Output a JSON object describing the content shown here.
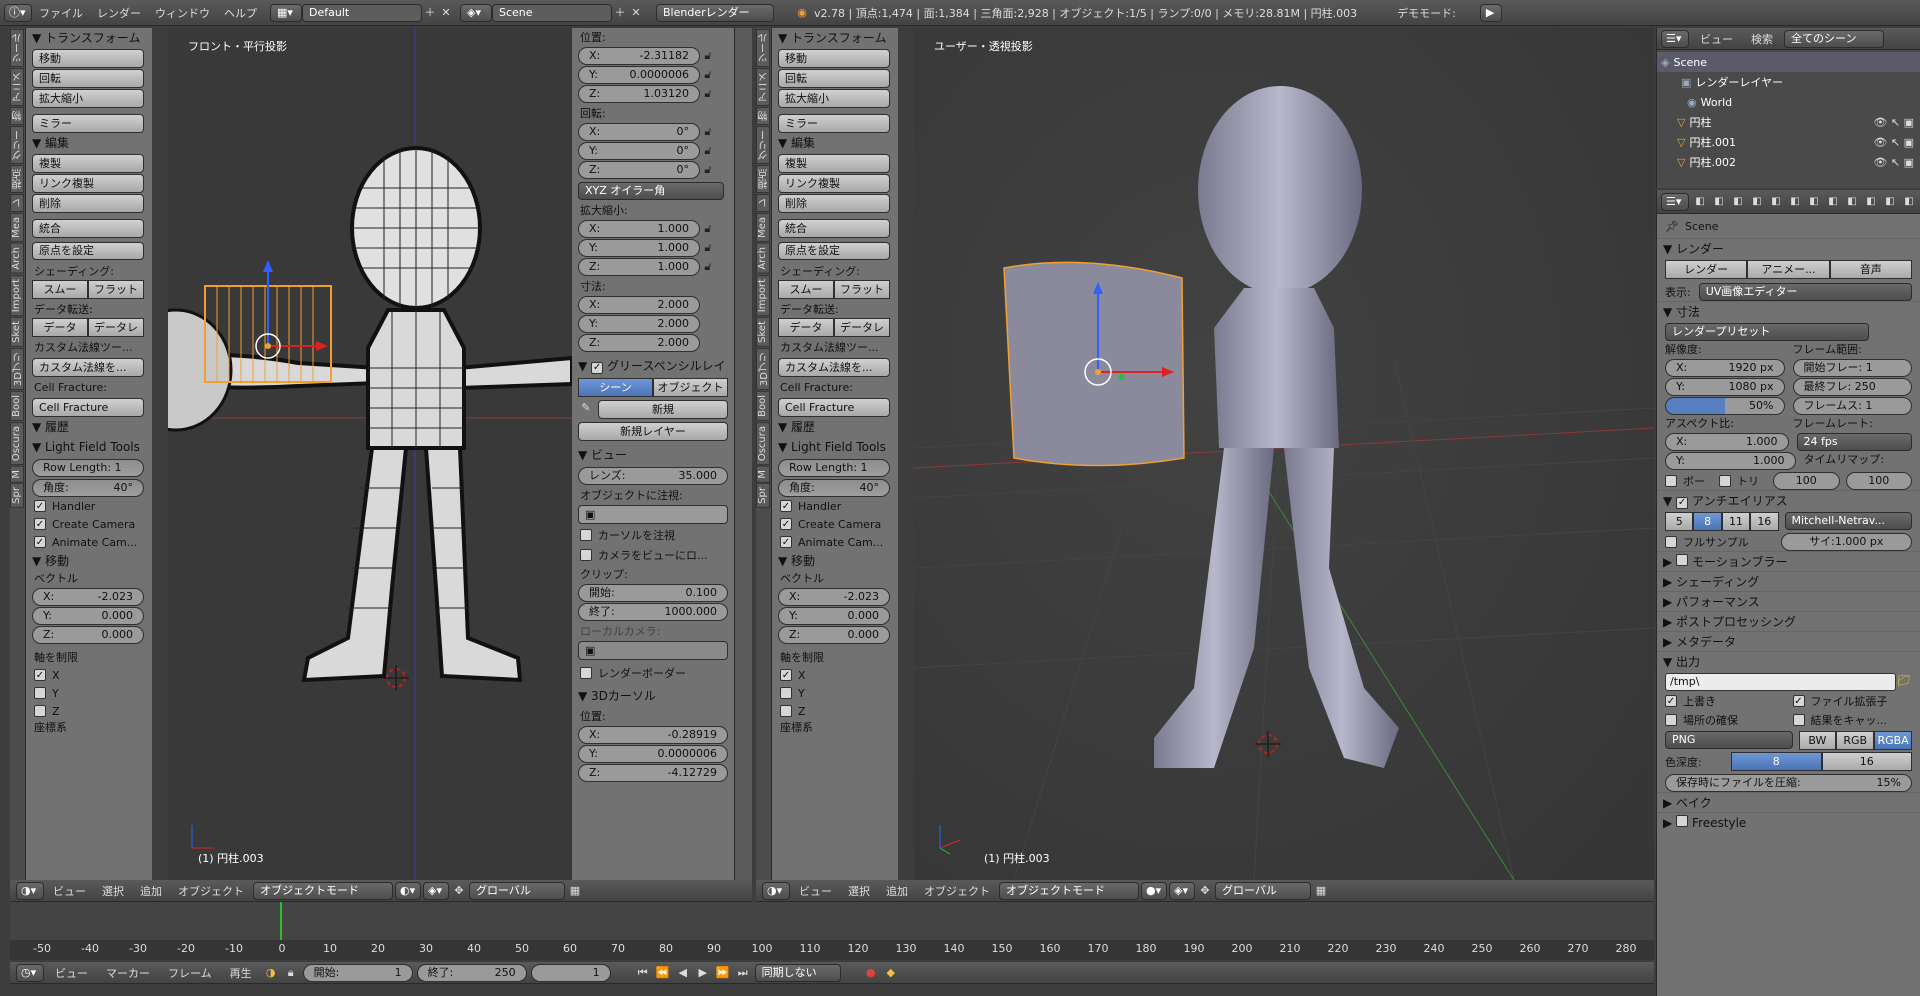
{
  "topbar": {
    "menus": [
      "ファイル",
      "レンダー",
      "ウィンドウ",
      "ヘルプ"
    ],
    "layout": "Default",
    "scene": "Scene",
    "engine": "Blenderレンダー",
    "stats": "v2.78 | 頂点:1,474 | 面:1,384 | 三角面:2,928 | オブジェクト:1/5 | ランプ:0/0 | メモリ:28.81M | 円柱.003",
    "demo_label": "デモモード:"
  },
  "tool_shelf": {
    "tabs": [
      "ツール",
      "アニメ",
      "物",
      "グリー",
      "視点",
      "レ",
      "Mea",
      "Arch",
      "Import",
      "Sket",
      "3Dプリ",
      "Bool",
      "Oscura",
      "M",
      "Spr"
    ],
    "transform_title": "トランスフォーム",
    "transform_buttons": [
      "移動",
      "回転",
      "拡大縮小"
    ],
    "mirror": "ミラー",
    "edit_title": "編集",
    "edit_buttons": [
      "複製",
      "リンク複製",
      "削除"
    ],
    "join": "統合",
    "set_origin": "原点を設定",
    "shading_label": "シェーディング:",
    "shading_buttons": [
      "スムー",
      "フラット"
    ],
    "data_transfer_label": "データ転送:",
    "data_buttons": [
      "データ",
      "データレ"
    ],
    "custom_normal_label": "カスタム法線ツー...",
    "custom_normal_btn": "カスタム法線を...",
    "cell_fracture_label": "Cell Fracture:",
    "cell_fracture_btn": "Cell Fracture",
    "history_title": "履歴",
    "lft_title": "Light Field Tools",
    "row_length": "Row Length: 1",
    "angle": "角度:",
    "angle_val": "40°",
    "checks": [
      "Handler",
      "Create Camera",
      "Animate Cam..."
    ],
    "operator_title": "移動",
    "vector_label": "ベクトル",
    "vec": [
      {
        "k": "X:",
        "v": "-2.023"
      },
      {
        "k": "Y:",
        "v": "0.000"
      },
      {
        "k": "Z:",
        "v": "0.000"
      }
    ],
    "constraint_label": "軸を制限",
    "axes": [
      "X",
      "Y",
      "Z"
    ],
    "coord_label": "座標系"
  },
  "viewport_left": {
    "title": "フロント・平行投影",
    "object": "(1) 円柱.003",
    "header": {
      "menus": [
        "ビュー",
        "選択",
        "追加",
        "オブジェクト"
      ],
      "mode": "オブジェクトモード",
      "orientation": "グローバル"
    }
  },
  "viewport_right": {
    "title": "ユーザー・透視投影",
    "object": "(1) 円柱.003",
    "header": {
      "menus": [
        "ビュー",
        "選択",
        "追加",
        "オブジェクト"
      ],
      "mode": "オブジェクトモード",
      "orientation": "グローバル"
    }
  },
  "properties_n": {
    "location_label": "位置:",
    "loc": [
      {
        "k": "X:",
        "v": "-2.31182"
      },
      {
        "k": "Y:",
        "v": "0.0000006"
      },
      {
        "k": "Z:",
        "v": "1.03120"
      }
    ],
    "rotation_label": "回転:",
    "rot": [
      {
        "k": "X:",
        "v": "0°"
      },
      {
        "k": "Y:",
        "v": "0°"
      },
      {
        "k": "Z:",
        "v": "0°"
      }
    ],
    "rot_mode": "XYZ オイラー角",
    "scale_label": "拡大縮小:",
    "scale": [
      {
        "k": "X:",
        "v": "1.000"
      },
      {
        "k": "Y:",
        "v": "1.000"
      },
      {
        "k": "Z:",
        "v": "1.000"
      }
    ],
    "dims_label": "寸法:",
    "dims": [
      {
        "k": "X:",
        "v": "2.000"
      },
      {
        "k": "Y:",
        "v": "2.000"
      },
      {
        "k": "Z:",
        "v": "2.000"
      }
    ],
    "gp_title": "グリースペンシルレイ",
    "gp_tabs": [
      "シーン",
      "オブジェクト"
    ],
    "gp_new": "新規",
    "gp_new_layer": "新規レイヤー",
    "view_title": "ビュー",
    "lens": "レンズ:",
    "lens_val": "35.000",
    "lock_label": "オブジェクトに注視:",
    "lock_cursor": "カーソルを注視",
    "lock_camera": "カメラをビューにロ...",
    "clip_label": "クリップ:",
    "clip_start": "開始:",
    "clip_start_val": "0.100",
    "clip_end": "終了:",
    "clip_end_val": "1000.000",
    "local_cam": "ローカルカメラ:",
    "render_border": "レンダーボーダー",
    "cursor_title": "3Dカーソル",
    "cursor_loc_label": "位置:",
    "cursor": [
      {
        "k": "X:",
        "v": "-0.28919"
      },
      {
        "k": "Y:",
        "v": "0.0000006"
      },
      {
        "k": "Z:",
        "v": "-4.12729"
      }
    ]
  },
  "outliner": {
    "menus": [
      "ビュー",
      "検索"
    ],
    "filter": "全てのシーン",
    "items": [
      "Scene",
      "レンダーレイヤー",
      "World",
      "円柱",
      "円柱.001",
      "円柱.002"
    ]
  },
  "properties": {
    "scene": "Scene",
    "render_title": "レンダー",
    "render_buttons": [
      "レンダー",
      "アニメー...",
      "音声"
    ],
    "display_label": "表示:",
    "display_val": "UV画像エディター",
    "dims_title": "寸法",
    "preset": "レンダープリセット",
    "res_label": "解像度:",
    "res_x": "X:",
    "res_x_val": "1920 px",
    "res_y": "Y:",
    "res_y_val": "1080 px",
    "res_pct": "50%",
    "frame_range_label": "フレーム範囲:",
    "frame_start": "開始フレー: 1",
    "frame_end": "最終フレ: 250",
    "frame_step": "フレームス: 1",
    "aspect_label": "アスペクト比:",
    "aspect_x": "X:",
    "aspect_x_val": "1.000",
    "aspect_y": "Y:",
    "aspect_y_val": "1.000",
    "fps_label": "フレームレート:",
    "fps": "24 fps",
    "border": "ボー",
    "crop": "トリ",
    "time_remap_label": "タイムリマップ:",
    "remap_old": "100",
    "remap_new": "100",
    "aa_title": "アンチエイリアス",
    "aa_samples": [
      "5",
      "8",
      "11",
      "16"
    ],
    "aa_filter": "Mitchell-Netrav...",
    "full_sample": "フルサンプル",
    "filter_size": "サイ:1.000 px",
    "collapsed": [
      "モーションブラー",
      "シェーディング",
      "パフォーマンス",
      "ポストプロセッシング",
      "メタデータ"
    ],
    "output_title": "出力",
    "output_path": "/tmp\\",
    "overwrite": "上書き",
    "file_ext": "ファイル拡張子",
    "placeholders": "場所の確保",
    "cache_result": "結果をキャッ...",
    "format": "PNG",
    "color_modes": [
      "BW",
      "RGB",
      "RGBA"
    ],
    "depth_label": "色深度:",
    "depth_vals": [
      "8",
      "16"
    ],
    "compression": "保存時にファイルを圧縮:",
    "compression_val": "15%",
    "bake_title": "ベイク",
    "freestyle_title": "Freestyle"
  },
  "timeline": {
    "ticks": [
      "-50",
      "-40",
      "-30",
      "-20",
      "-10",
      "0",
      "10",
      "20",
      "30",
      "40",
      "50",
      "60",
      "70",
      "80",
      "90",
      "100",
      "110",
      "120",
      "130",
      "140",
      "150",
      "160",
      "170",
      "180",
      "190",
      "200",
      "210",
      "220",
      "230",
      "240",
      "250",
      "260",
      "270",
      "280"
    ],
    "current_frame_value": 0,
    "menus": [
      "ビュー",
      "マーカー",
      "フレーム",
      "再生"
    ],
    "start": "開始:",
    "start_val": "1",
    "end": "終了:",
    "end_val": "250",
    "current": "1",
    "sync": "同期しない"
  },
  "colors": {
    "selected_outline": "#f0a030",
    "viewport_bg": "#393939",
    "accent_blue": "#5680c2"
  }
}
